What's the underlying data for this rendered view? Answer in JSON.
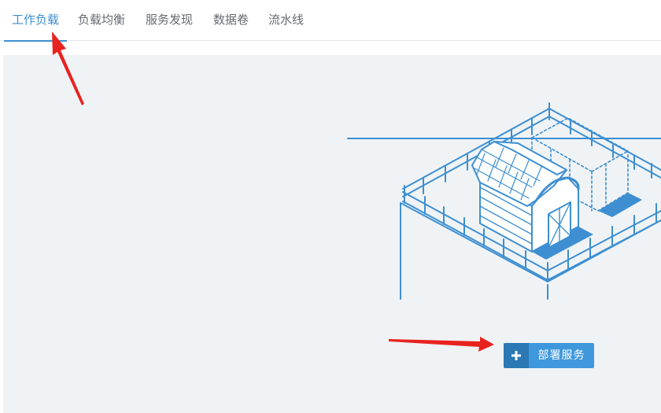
{
  "tabs": [
    {
      "label": "工作负载",
      "active": true
    },
    {
      "label": "负载均衡",
      "active": false
    },
    {
      "label": "服务发现",
      "active": false
    },
    {
      "label": "数据卷",
      "active": false
    },
    {
      "label": "流水线",
      "active": false
    }
  ],
  "main": {
    "deploy_button_label": "部署服务",
    "deploy_button_icon": "plus-icon"
  },
  "colors": {
    "accent": "#3d8fd1",
    "button": "#3f98dc",
    "button_icon_bg": "#2b78b5",
    "annotation_arrow": "#e8231f",
    "illustration": "#3d8fd1"
  },
  "annotations": {
    "arrows": [
      "red-arrow-icon",
      "red-arrow-icon"
    ]
  }
}
